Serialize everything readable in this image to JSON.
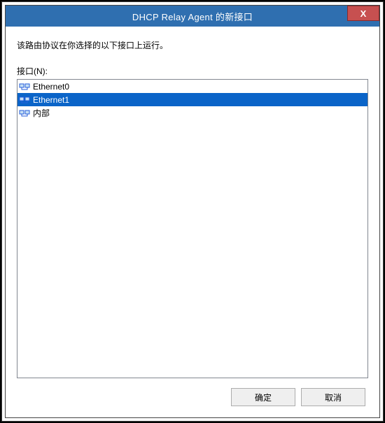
{
  "window": {
    "title": "DHCP Relay Agent 的新接口",
    "close_label": "X"
  },
  "dialog": {
    "description": "该路由协议在你选择的以下接口上运行。",
    "interfaces_label": "接口(N):"
  },
  "interfaces": [
    {
      "name": "Ethernet0",
      "selected": false
    },
    {
      "name": "Ethernet1",
      "selected": true
    },
    {
      "name": "内部",
      "selected": false
    }
  ],
  "buttons": {
    "ok": "确定",
    "cancel": "取消"
  }
}
